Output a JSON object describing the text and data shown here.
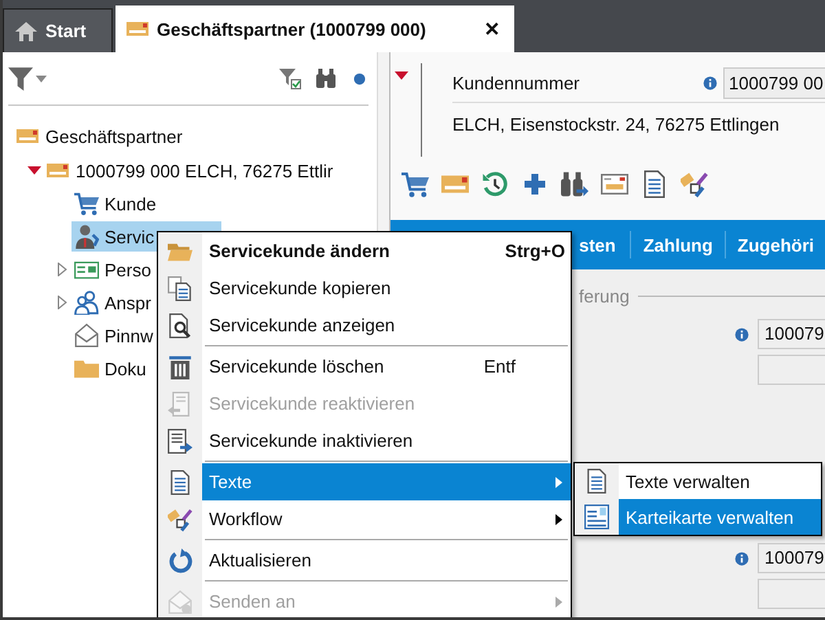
{
  "tabs": [
    {
      "label": "Start",
      "selected": false
    },
    {
      "label": "Geschäftspartner (1000799 000)",
      "selected": true,
      "close": "✕"
    }
  ],
  "tree": [
    {
      "label": "Geschäftspartner",
      "selected": false,
      "children": [
        {
          "label": "1000799  000  ELCH, 76275 Ettlir",
          "selected": false,
          "expanded": true,
          "children": [
            {
              "label": "Kunde",
              "selected": false
            },
            {
              "label": "Servic",
              "selected": true
            },
            {
              "label": "Perso",
              "selected": false,
              "expanded": false
            },
            {
              "label": "Anspr",
              "selected": false,
              "expanded": false
            },
            {
              "label": "Pinnw",
              "selected": false
            },
            {
              "label": "Doku",
              "selected": false
            }
          ]
        }
      ]
    }
  ],
  "header": {
    "label": "Kundennummer",
    "value": "1000799 00",
    "address": "ELCH, Eisenstockstr. 24, 76275 Ettlingen"
  },
  "detail_tabs": [
    "sten",
    "Zahlung",
    "Zugehöri"
  ],
  "group": {
    "label": "ferung",
    "fields": [
      {
        "value": "100079",
        "info": true
      },
      {
        "info": false
      },
      {
        "value": "100079",
        "info": true
      },
      {
        "info": false
      }
    ]
  },
  "context_menu": [
    {
      "kind": "item",
      "label": "Servicekunde ändern",
      "shortcut": "Strg+O",
      "bold": true,
      "disabled": false,
      "selected": false
    },
    {
      "kind": "item",
      "label": "Servicekunde kopieren",
      "disabled": false,
      "selected": false
    },
    {
      "kind": "item",
      "label": "Servicekunde anzeigen",
      "disabled": false,
      "selected": false
    },
    {
      "kind": "separator"
    },
    {
      "kind": "item",
      "label": "Servicekunde löschen",
      "shortcut": "Entf",
      "disabled": false,
      "selected": false
    },
    {
      "kind": "item",
      "label": "Servicekunde reaktivieren",
      "disabled": true,
      "selected": false
    },
    {
      "kind": "item",
      "label": "Servicekunde inaktivieren",
      "disabled": false,
      "selected": false
    },
    {
      "kind": "separator"
    },
    {
      "kind": "item",
      "label": "Texte",
      "submenu": true,
      "disabled": false,
      "selected": true
    },
    {
      "kind": "item",
      "label": "Workflow",
      "submenu": true,
      "disabled": false,
      "selected": false
    },
    {
      "kind": "separator"
    },
    {
      "kind": "item",
      "label": "Aktualisieren",
      "disabled": false,
      "selected": false
    },
    {
      "kind": "separator"
    },
    {
      "kind": "item",
      "label": "Senden an",
      "submenu": true,
      "disabled": true,
      "selected": false
    }
  ],
  "submenu": [
    {
      "label": "Texte verwalten",
      "selected": false
    },
    {
      "label": "Karteikarte verwalten",
      "selected": true
    }
  ]
}
